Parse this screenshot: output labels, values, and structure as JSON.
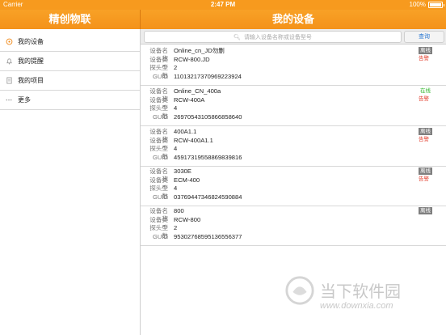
{
  "status": {
    "carrier": "Carrier",
    "time": "2:47 PM",
    "battery": "100%",
    "battery_level": 1.0
  },
  "left_nav": {
    "title": "精创物联"
  },
  "right_nav": {
    "title": "我的设备"
  },
  "sidebar": {
    "items": [
      {
        "label": "我的设备",
        "icon": "device-icon"
      },
      {
        "label": "我的提醒",
        "icon": "bell-icon"
      },
      {
        "label": "我的项目",
        "icon": "document-icon"
      },
      {
        "label": "更多",
        "icon": "more-icon"
      }
    ]
  },
  "search": {
    "placeholder": "请输入设备名称或设备型号",
    "button": "查询"
  },
  "field_labels": {
    "name": "设备名称",
    "type": "设备类型",
    "probes": "探头个数",
    "guid": "GUID"
  },
  "devices": [
    {
      "name": "Online_cn_JD勿删",
      "type": "RCW-800.JD",
      "probes": "2",
      "guid": "11013217370969223924",
      "status": "离线",
      "alarm": "告警"
    },
    {
      "name": "Online_CN_400a",
      "type": "RCW-400A",
      "probes": "4",
      "guid": "26970543105866858640",
      "status": "在线",
      "alarm": "告警"
    },
    {
      "name": "400A1.1",
      "type": "RCW-400A1.1",
      "probes": "4",
      "guid": "45917319558869839816",
      "status": "离线",
      "alarm": "告警"
    },
    {
      "name": "3030E",
      "type": "ECM-400",
      "probes": "4",
      "guid": "03769447346824590884",
      "status": "离线",
      "alarm": "告警"
    },
    {
      "name": "800",
      "type": "RCW-800",
      "probes": "2",
      "guid": "95302768595136556377",
      "status": "离线",
      "alarm": ""
    }
  ],
  "watermark": {
    "text": "当下软件园",
    "url": "www.downxia.com"
  },
  "colors": {
    "accent": "#f4921a",
    "online": "#2cb327",
    "alarm": "#e23b2a",
    "offline_badge": "#7f7f7f"
  }
}
